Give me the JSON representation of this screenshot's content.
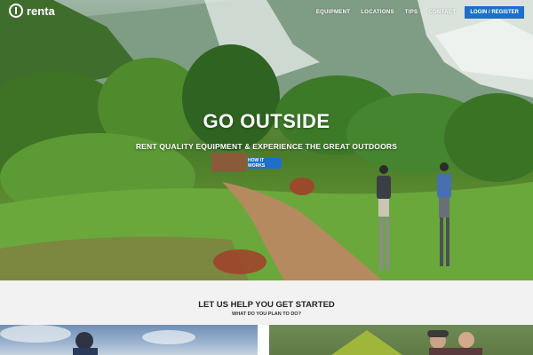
{
  "brand": {
    "name": "renta"
  },
  "nav": {
    "links": [
      "EQUIPMENT",
      "LOCATIONS",
      "TIPS",
      "CONTACT"
    ],
    "login_label": "LOGIN / REGISTER"
  },
  "hero": {
    "headline": "GO OUTSIDE",
    "subheadline": "RENT QUALITY EQUIPMENT & EXPERIENCE THE GREAT OUTDOORS",
    "cta_label": "HOW IT WORKS"
  },
  "get_started": {
    "title": "LET US HELP YOU GET STARTED",
    "subtitle": "WHAT DO YOU PLAN TO DO?"
  },
  "colors": {
    "accent": "#1e6fc8",
    "section_bg": "#f2f2f2"
  }
}
